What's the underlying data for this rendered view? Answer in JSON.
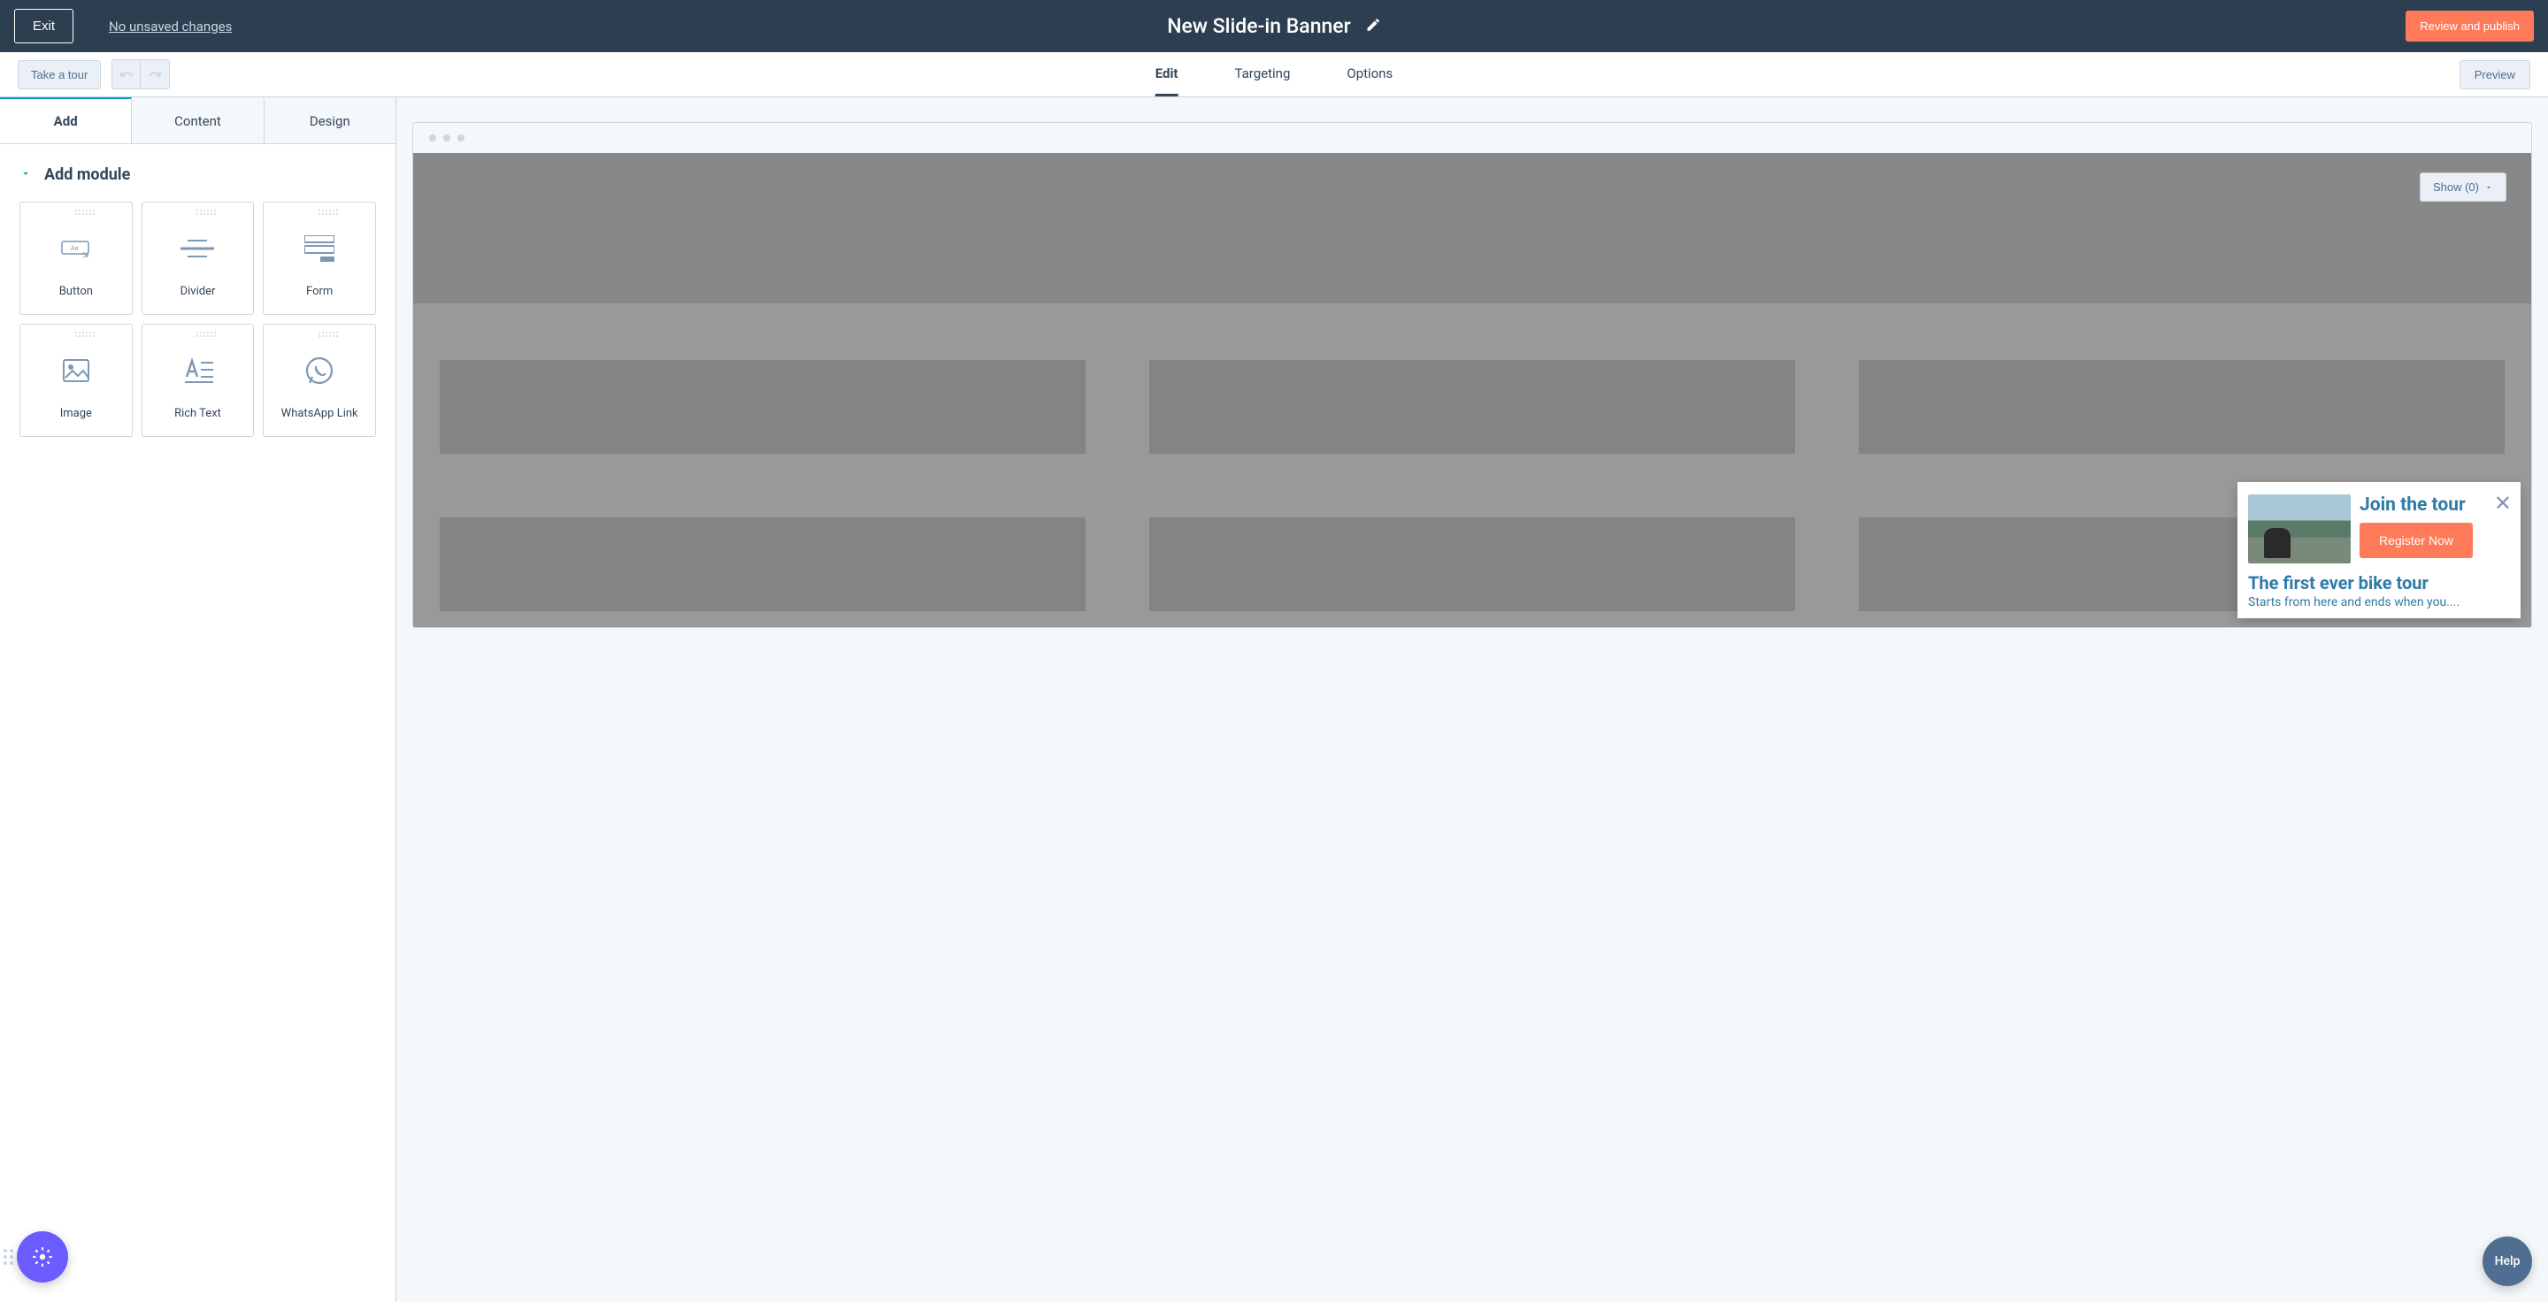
{
  "header": {
    "exit": "Exit",
    "unsaved": "No unsaved changes",
    "title": "New Slide-in Banner",
    "review": "Review and publish"
  },
  "toolbar": {
    "tour": "Take a tour",
    "tabs": {
      "edit": "Edit",
      "targeting": "Targeting",
      "options": "Options"
    },
    "preview": "Preview"
  },
  "sidebar": {
    "tabs": {
      "add": "Add",
      "content": "Content",
      "design": "Design"
    },
    "section_title": "Add module",
    "modules": {
      "button": "Button",
      "divider": "Divider",
      "form": "Form",
      "image": "Image",
      "richtext": "Rich Text",
      "whatsapp": "WhatsApp Link"
    }
  },
  "canvas": {
    "show_label": "Show (0)"
  },
  "slidein": {
    "heading": "Join the tour",
    "cta": "Register Now",
    "subheading": "The first ever bike tour",
    "body": "Starts from here and ends when you...."
  },
  "help": "Help"
}
